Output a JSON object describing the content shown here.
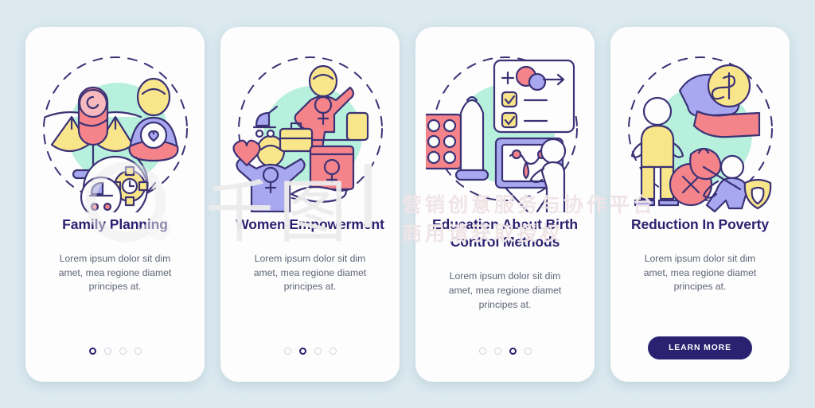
{
  "background_color": "#dceaf0",
  "theme": {
    "title_color": "#2b2170",
    "body_color": "#5d6576",
    "card_color": "#fdfdfd",
    "accent_button": "#2a2170",
    "mint": "#b7f0dc",
    "pink": "#f4838a",
    "yellow": "#fae68a",
    "periwinkle": "#a7a8ef",
    "outline": "#3b3276"
  },
  "watermark": {
    "brand": "千图",
    "line1": "营销创意服务与协作平台",
    "line2": "商用请获取授权"
  },
  "screens": [
    {
      "title": "Family Planning",
      "description": "Lorem ipsum dolor sit dim amet, mea regione diamet principes at.",
      "dots": 4,
      "active_dot": 1,
      "has_cta": false,
      "cta_label": "",
      "illustration": "family-planning-illustration",
      "illustration_parts": [
        "balance-scales-icon",
        "swaddled-baby-icon",
        "mother-with-heart-icon",
        "clock-gear-icon",
        "stroller-icon",
        "dashed-circle"
      ]
    },
    {
      "title": "Women Empowerment",
      "description": "Lorem ipsum dolor sit dim amet, mea regione diamet principes at.",
      "dots": 4,
      "active_dot": 2,
      "has_cta": false,
      "cta_label": "",
      "illustration": "women-empowerment-illustration",
      "illustration_parts": [
        "woman-raising-arm-icon",
        "venus-symbol-icon",
        "stroller-icon",
        "briefcase-icon",
        "heart-icon",
        "book-icon",
        "open-hand-icon",
        "dashed-circle"
      ]
    },
    {
      "title": "Education About Birth Control Methods",
      "description": "Lorem ipsum dolor sit dim amet, mea regione diamet principes at.",
      "dots": 4,
      "active_dot": 3,
      "has_cta": false,
      "cta_label": "",
      "illustration": "birth-control-education-illustration",
      "illustration_parts": [
        "pill-blister-pack-icon",
        "condom-icon",
        "checklist-board-icon",
        "sperm-egg-icon",
        "presentation-board-icon",
        "presenter-person-icon",
        "dashed-circle"
      ]
    },
    {
      "title": "Reduction In Poverty",
      "description": "Lorem ipsum dolor sit dim amet, mea regione diamet principes at.",
      "dots": 4,
      "active_dot": 4,
      "has_cta": true,
      "cta_label": "LEARN MORE",
      "illustration": "poverty-reduction-illustration",
      "illustration_parts": [
        "dollar-coin-icon",
        "giving-hand-icon",
        "empty-pockets-person-icon",
        "x-circle-icon",
        "money-bag-icon",
        "running-person-icon",
        "shield-icon",
        "dashed-circle"
      ]
    }
  ]
}
